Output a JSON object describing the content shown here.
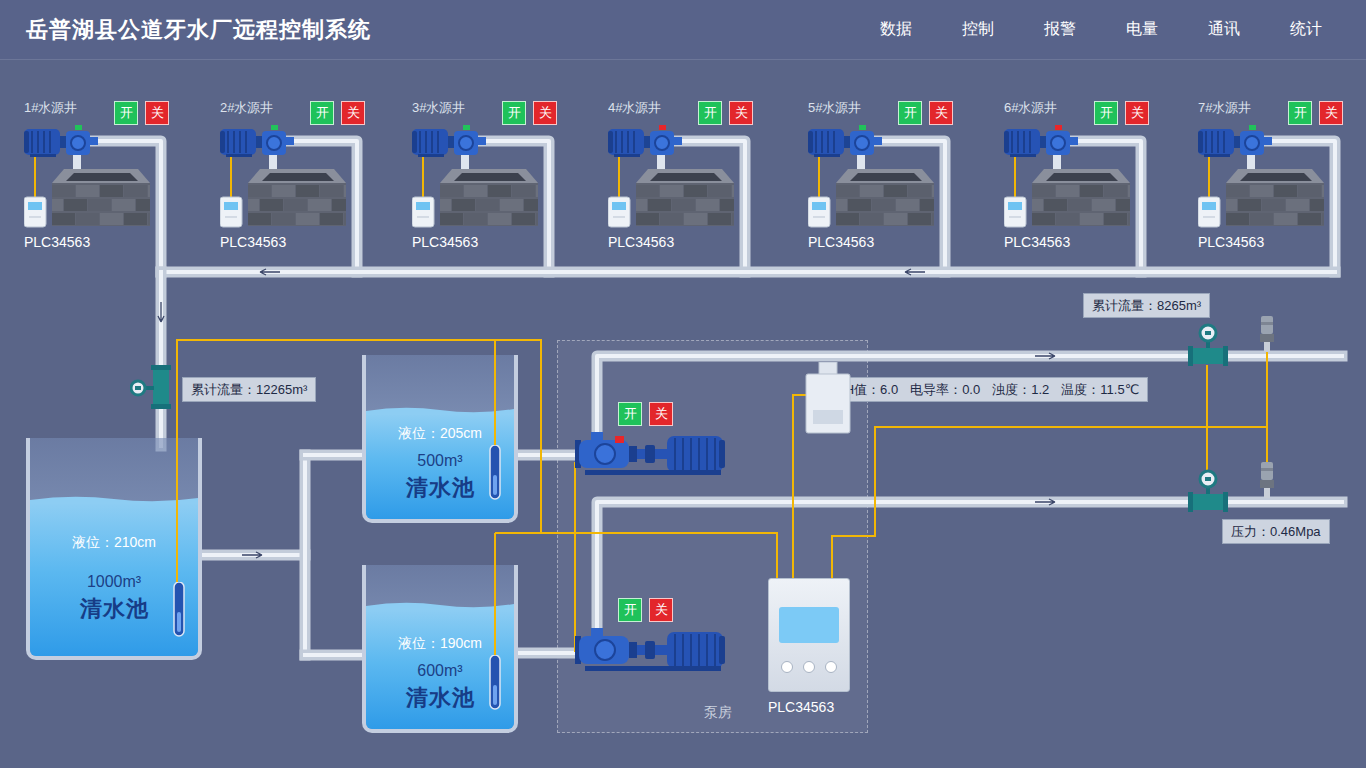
{
  "header": {
    "title": "岳普湖县公道牙水厂远程控制系统",
    "nav": [
      {
        "label": "数据"
      },
      {
        "label": "控制"
      },
      {
        "label": "报警"
      },
      {
        "label": "电量"
      },
      {
        "label": "通讯"
      },
      {
        "label": "统计"
      }
    ]
  },
  "wells": [
    {
      "name": "1#水源井",
      "plc": "PLC34563",
      "running": true,
      "buttons": [
        {
          "label": "开",
          "kind": "on"
        },
        {
          "label": "关",
          "kind": "off"
        }
      ]
    },
    {
      "name": "2#水源井",
      "plc": "PLC34563",
      "running": true,
      "buttons": [
        {
          "label": "开",
          "kind": "on"
        },
        {
          "label": "关",
          "kind": "off"
        }
      ]
    },
    {
      "name": "3#水源井",
      "plc": "PLC34563",
      "running": true,
      "buttons": [
        {
          "label": "开",
          "kind": "on"
        },
        {
          "label": "关",
          "kind": "off"
        }
      ]
    },
    {
      "name": "4#水源井",
      "plc": "PLC34563",
      "running": false,
      "buttons": [
        {
          "label": "开",
          "kind": "on"
        },
        {
          "label": "关",
          "kind": "off"
        }
      ]
    },
    {
      "name": "5#水源井",
      "plc": "PLC34563",
      "running": true,
      "buttons": [
        {
          "label": "开",
          "kind": "on"
        },
        {
          "label": "关",
          "kind": "off"
        }
      ]
    },
    {
      "name": "6#水源井",
      "plc": "PLC34563",
      "running": false,
      "buttons": [
        {
          "label": "开",
          "kind": "on"
        },
        {
          "label": "关",
          "kind": "off"
        }
      ]
    },
    {
      "name": "7#水源井",
      "plc": "PLC34563",
      "running": true,
      "buttons": [
        {
          "label": "开",
          "kind": "on"
        },
        {
          "label": "关",
          "kind": "off"
        }
      ]
    }
  ],
  "inlet_flow": {
    "label": "累计流量：12265m³"
  },
  "tanks": [
    {
      "level_text": "液位：210cm",
      "capacity": "1000m³",
      "name": "清水池",
      "level": 0.7
    },
    {
      "level_text": "液位：205cm",
      "capacity": "500m³",
      "name": "清水池",
      "level": 0.64
    },
    {
      "level_text": "液位：190cm",
      "capacity": "600m³",
      "name": "清水池",
      "level": 0.73
    }
  ],
  "pump_room": {
    "label": "泵房",
    "plc": "PLC34563"
  },
  "pumps": [
    {
      "running": false,
      "buttons": [
        {
          "label": "开",
          "kind": "on"
        },
        {
          "label": "关",
          "kind": "off"
        }
      ]
    },
    {
      "buttons": [
        {
          "label": "开",
          "kind": "on"
        },
        {
          "label": "关",
          "kind": "off"
        }
      ]
    }
  ],
  "water_quality": [
    "PH值：6.0",
    "电导率：0.0",
    "浊度：1.2",
    "温度：11.5℃"
  ],
  "outlet_flow": {
    "label": "累计流量：8265m³"
  },
  "pressure": {
    "label": "压力：0.46Mpa"
  }
}
